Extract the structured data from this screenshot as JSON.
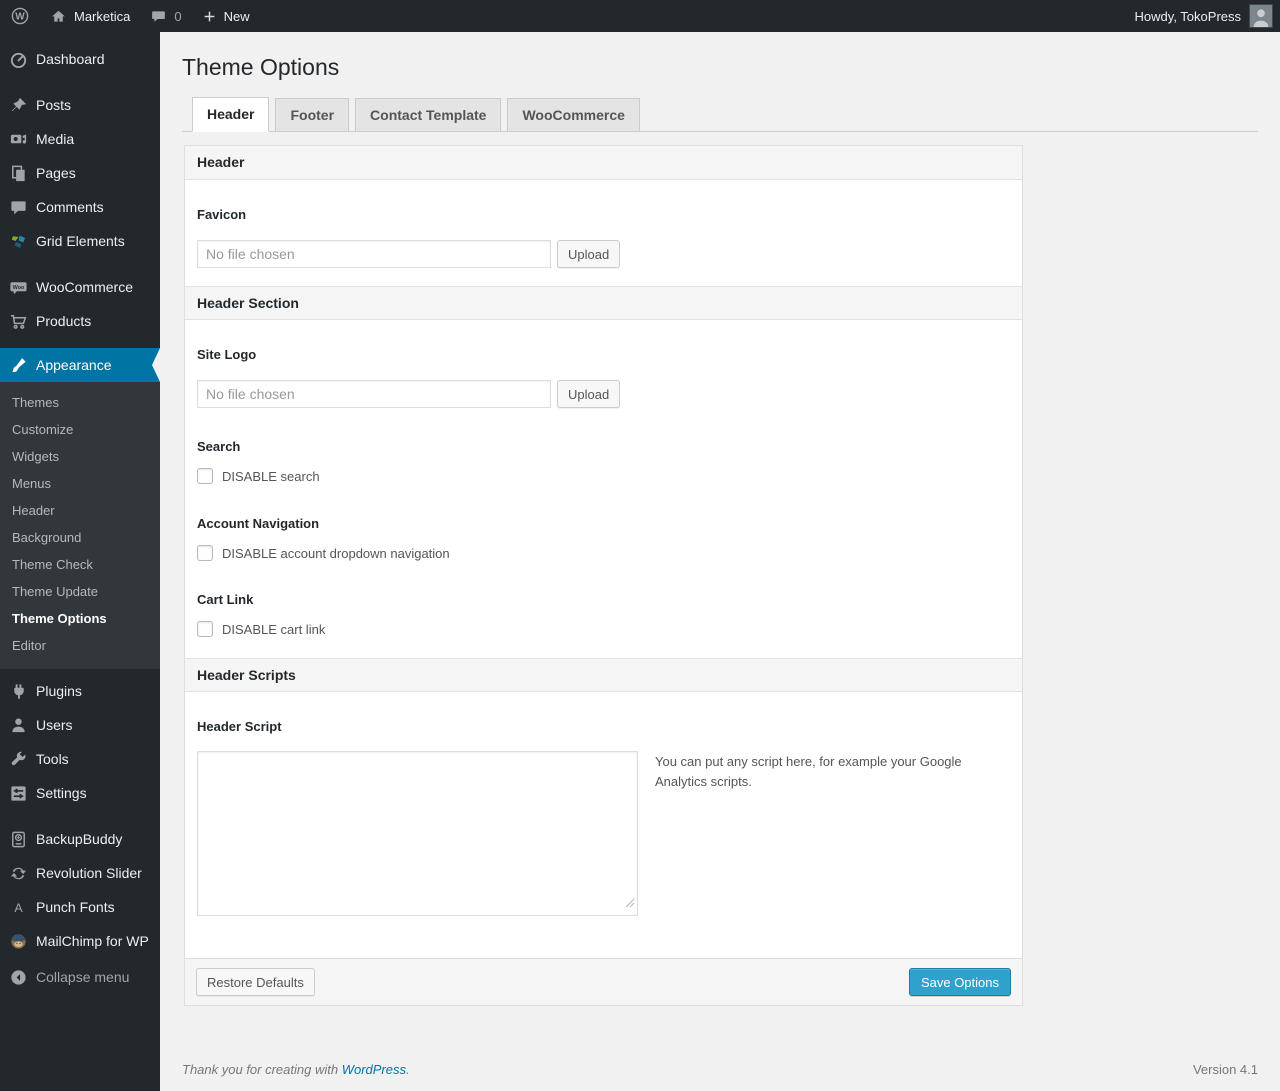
{
  "admin_bar": {
    "site_name": "Marketica",
    "comment_count": "0",
    "new_label": "New",
    "howdy": "Howdy, TokoPress"
  },
  "sidebar": {
    "items": [
      {
        "label": "Dashboard"
      },
      {
        "label": "Posts"
      },
      {
        "label": "Media"
      },
      {
        "label": "Pages"
      },
      {
        "label": "Comments"
      },
      {
        "label": "Grid Elements"
      },
      {
        "label": "WooCommerce"
      },
      {
        "label": "Products"
      },
      {
        "label": "Appearance"
      },
      {
        "label": "Plugins"
      },
      {
        "label": "Users"
      },
      {
        "label": "Tools"
      },
      {
        "label": "Settings"
      },
      {
        "label": "BackupBuddy"
      },
      {
        "label": "Revolution Slider"
      },
      {
        "label": "Punch Fonts"
      },
      {
        "label": "MailChimp for WP"
      }
    ],
    "submenu": [
      {
        "label": "Themes"
      },
      {
        "label": "Customize"
      },
      {
        "label": "Widgets"
      },
      {
        "label": "Menus"
      },
      {
        "label": "Header"
      },
      {
        "label": "Background"
      },
      {
        "label": "Theme Check"
      },
      {
        "label": "Theme Update"
      },
      {
        "label": "Theme Options",
        "current": true
      },
      {
        "label": "Editor"
      }
    ],
    "collapse_label": "Collapse menu"
  },
  "page": {
    "title": "Theme Options",
    "tabs": [
      {
        "label": "Header",
        "active": true
      },
      {
        "label": "Footer"
      },
      {
        "label": "Contact Template"
      },
      {
        "label": "WooCommerce"
      }
    ]
  },
  "panel": {
    "section_header": "Header",
    "section_header_section": "Header Section",
    "section_header_scripts": "Header Scripts",
    "favicon": {
      "label": "Favicon",
      "value": "No file chosen",
      "upload": "Upload"
    },
    "site_logo": {
      "label": "Site Logo",
      "value": "No file chosen",
      "upload": "Upload"
    },
    "search": {
      "label": "Search",
      "checkbox_label": "DISABLE search",
      "checked": false
    },
    "account_nav": {
      "label": "Account Navigation",
      "checkbox_label": "DISABLE account dropdown navigation",
      "checked": false
    },
    "cart_link": {
      "label": "Cart Link",
      "checkbox_label": "DISABLE cart link",
      "checked": false
    },
    "header_script": {
      "label": "Header Script",
      "value": "",
      "help": "You can put any script here, for example your Google Analytics scripts."
    },
    "restore_label": "Restore Defaults",
    "save_label": "Save Options"
  },
  "footer": {
    "thanks_prefix": "Thank you for creating with ",
    "thanks_link": "WordPress",
    "thanks_suffix": ".",
    "version": "Version 4.1"
  },
  "colors": {
    "accent": "#0074a2",
    "primary_button": "#2ea2cc",
    "admin_bar_bg": "#23282d",
    "submenu_bg": "#32373c",
    "page_bg": "#f1f1f1"
  }
}
